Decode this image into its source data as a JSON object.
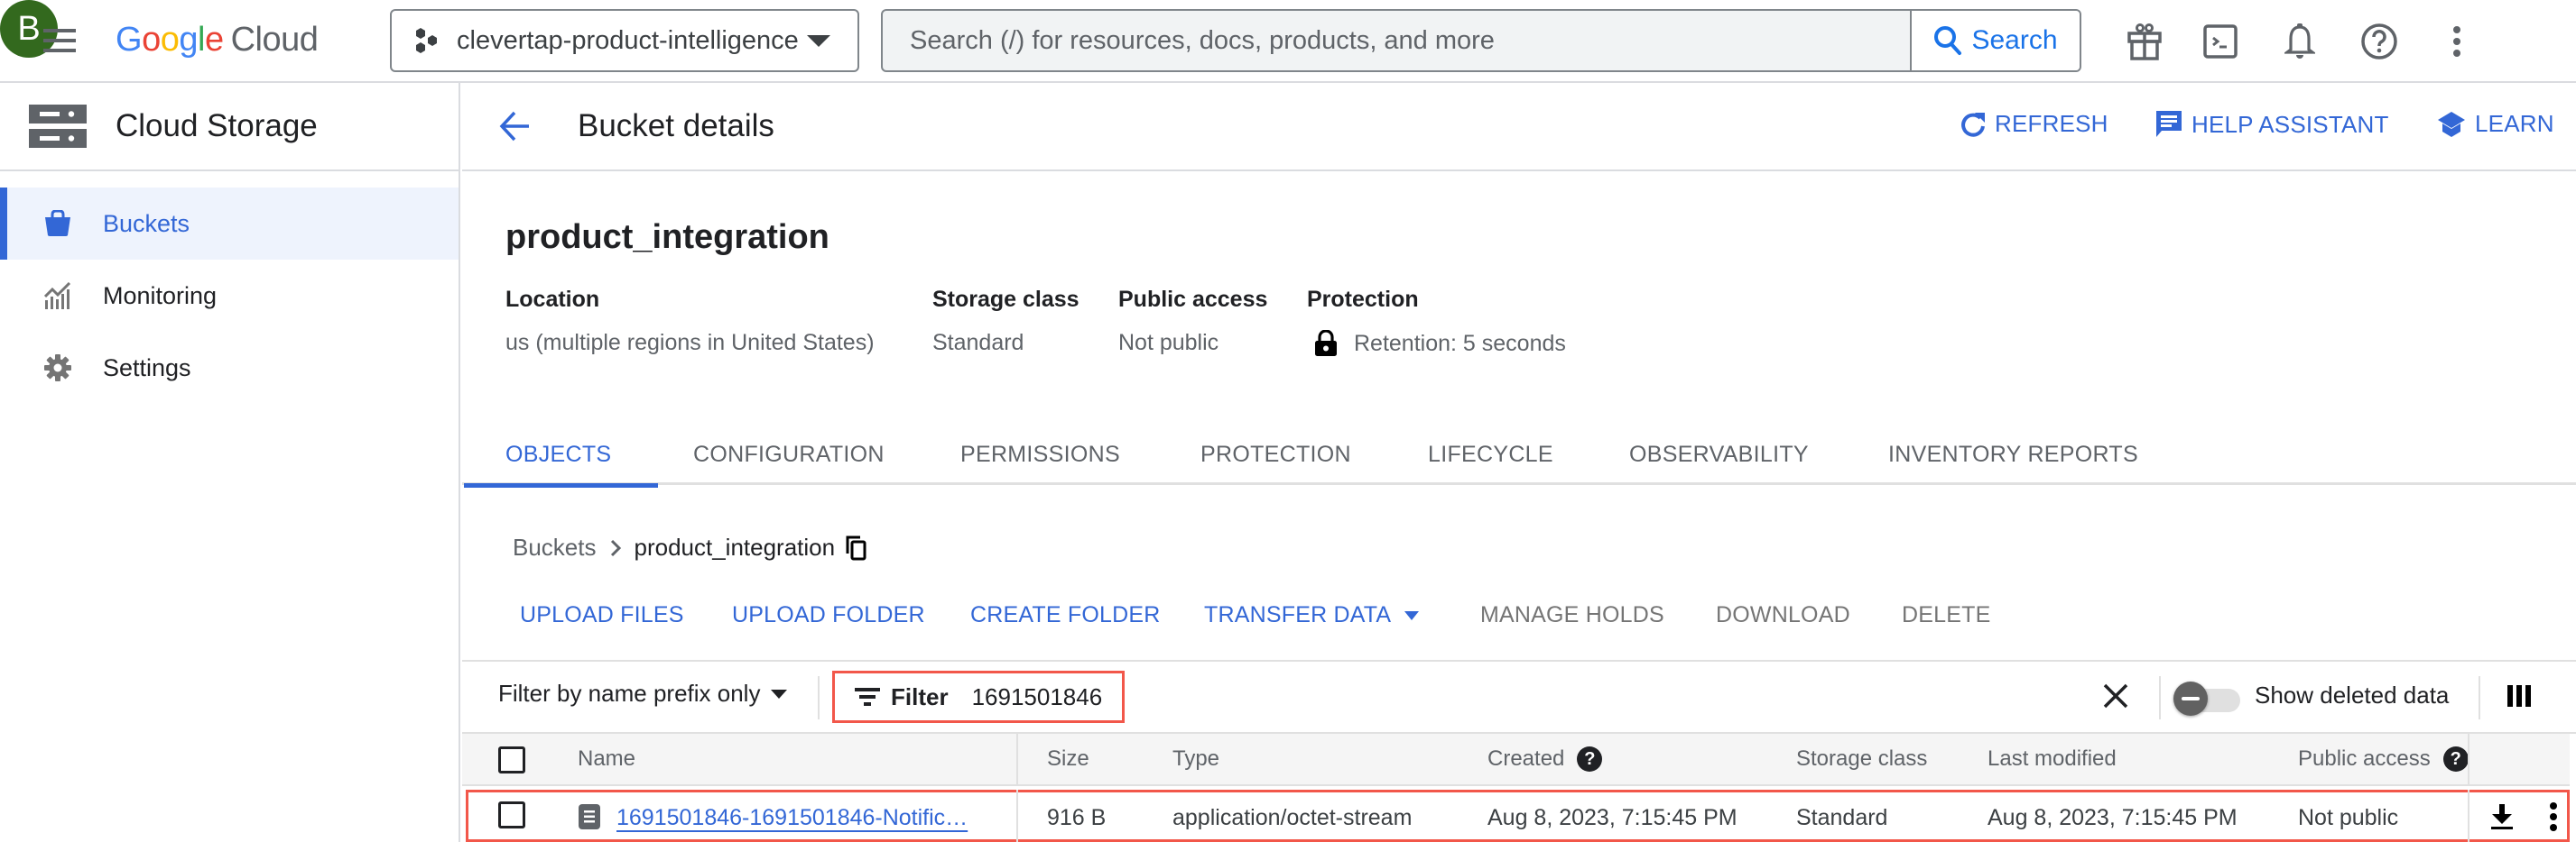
{
  "topbar": {
    "logo_letters": [
      "G",
      "o",
      "o",
      "g",
      "l",
      "e"
    ],
    "logo_suffix": "Cloud",
    "project": "clevertap-product-intelligence",
    "search_placeholder": "Search (/) for resources, docs, products, and more",
    "search_value": "",
    "search_button": "Search",
    "avatar_initial": "B",
    "icons": [
      "gift-icon",
      "cloud-shell-icon",
      "notifications-icon",
      "help-icon",
      "more-vert-icon"
    ]
  },
  "sidebar": {
    "title": "Cloud Storage",
    "items": [
      {
        "label": "Buckets",
        "icon": "bucket-icon",
        "active": true
      },
      {
        "label": "Monitoring",
        "icon": "monitoring-icon",
        "active": false
      },
      {
        "label": "Settings",
        "icon": "gear-icon",
        "active": false
      }
    ]
  },
  "header": {
    "title": "Bucket details",
    "actions": [
      {
        "label": "REFRESH",
        "icon": "refresh-icon"
      },
      {
        "label": "HELP ASSISTANT",
        "icon": "help-assistant-icon"
      },
      {
        "label": "LEARN",
        "icon": "learn-icon"
      }
    ]
  },
  "bucket": {
    "name": "product_integration",
    "meta": [
      {
        "label": "Location",
        "value": "us (multiple regions in United States)"
      },
      {
        "label": "Storage class",
        "value": "Standard"
      },
      {
        "label": "Public access",
        "value": "Not public"
      },
      {
        "label": "Protection",
        "value": "Retention: 5 seconds"
      }
    ]
  },
  "tabs": [
    {
      "label": "OBJECTS",
      "active": true
    },
    {
      "label": "CONFIGURATION",
      "active": false
    },
    {
      "label": "PERMISSIONS",
      "active": false
    },
    {
      "label": "PROTECTION",
      "active": false
    },
    {
      "label": "LIFECYCLE",
      "active": false
    },
    {
      "label": "OBSERVABILITY",
      "active": false
    },
    {
      "label": "INVENTORY REPORTS",
      "active": false
    }
  ],
  "breadcrumb": {
    "root": "Buckets",
    "current": "product_integration"
  },
  "actions": [
    {
      "label": "UPLOAD FILES",
      "enabled": true
    },
    {
      "label": "UPLOAD FOLDER",
      "enabled": true
    },
    {
      "label": "CREATE FOLDER",
      "enabled": true
    },
    {
      "label": "TRANSFER DATA",
      "enabled": true,
      "dropdown": true
    },
    {
      "label": "MANAGE HOLDS",
      "enabled": false
    },
    {
      "label": "DOWNLOAD",
      "enabled": false
    },
    {
      "label": "DELETE",
      "enabled": false
    }
  ],
  "filter": {
    "mode": "Filter by name prefix only",
    "label": "Filter",
    "value": "1691501846",
    "show_deleted_label": "Show deleted data",
    "show_deleted": false
  },
  "table": {
    "columns": [
      "Name",
      "Size",
      "Type",
      "Created",
      "Storage class",
      "Last modified",
      "Public access"
    ],
    "rows": [
      {
        "name": "1691501846-1691501846-Notific…",
        "size": "916 B",
        "type": "application/octet-stream",
        "created": "Aug 8, 2023, 7:15:45 PM",
        "storage_class": "Standard",
        "last_modified": "Aug 8, 2023, 7:15:45 PM",
        "public_access": "Not public"
      }
    ]
  },
  "colors": {
    "accent": "#3367d6",
    "highlight": "#f2574a",
    "avatar": "#33691e"
  }
}
